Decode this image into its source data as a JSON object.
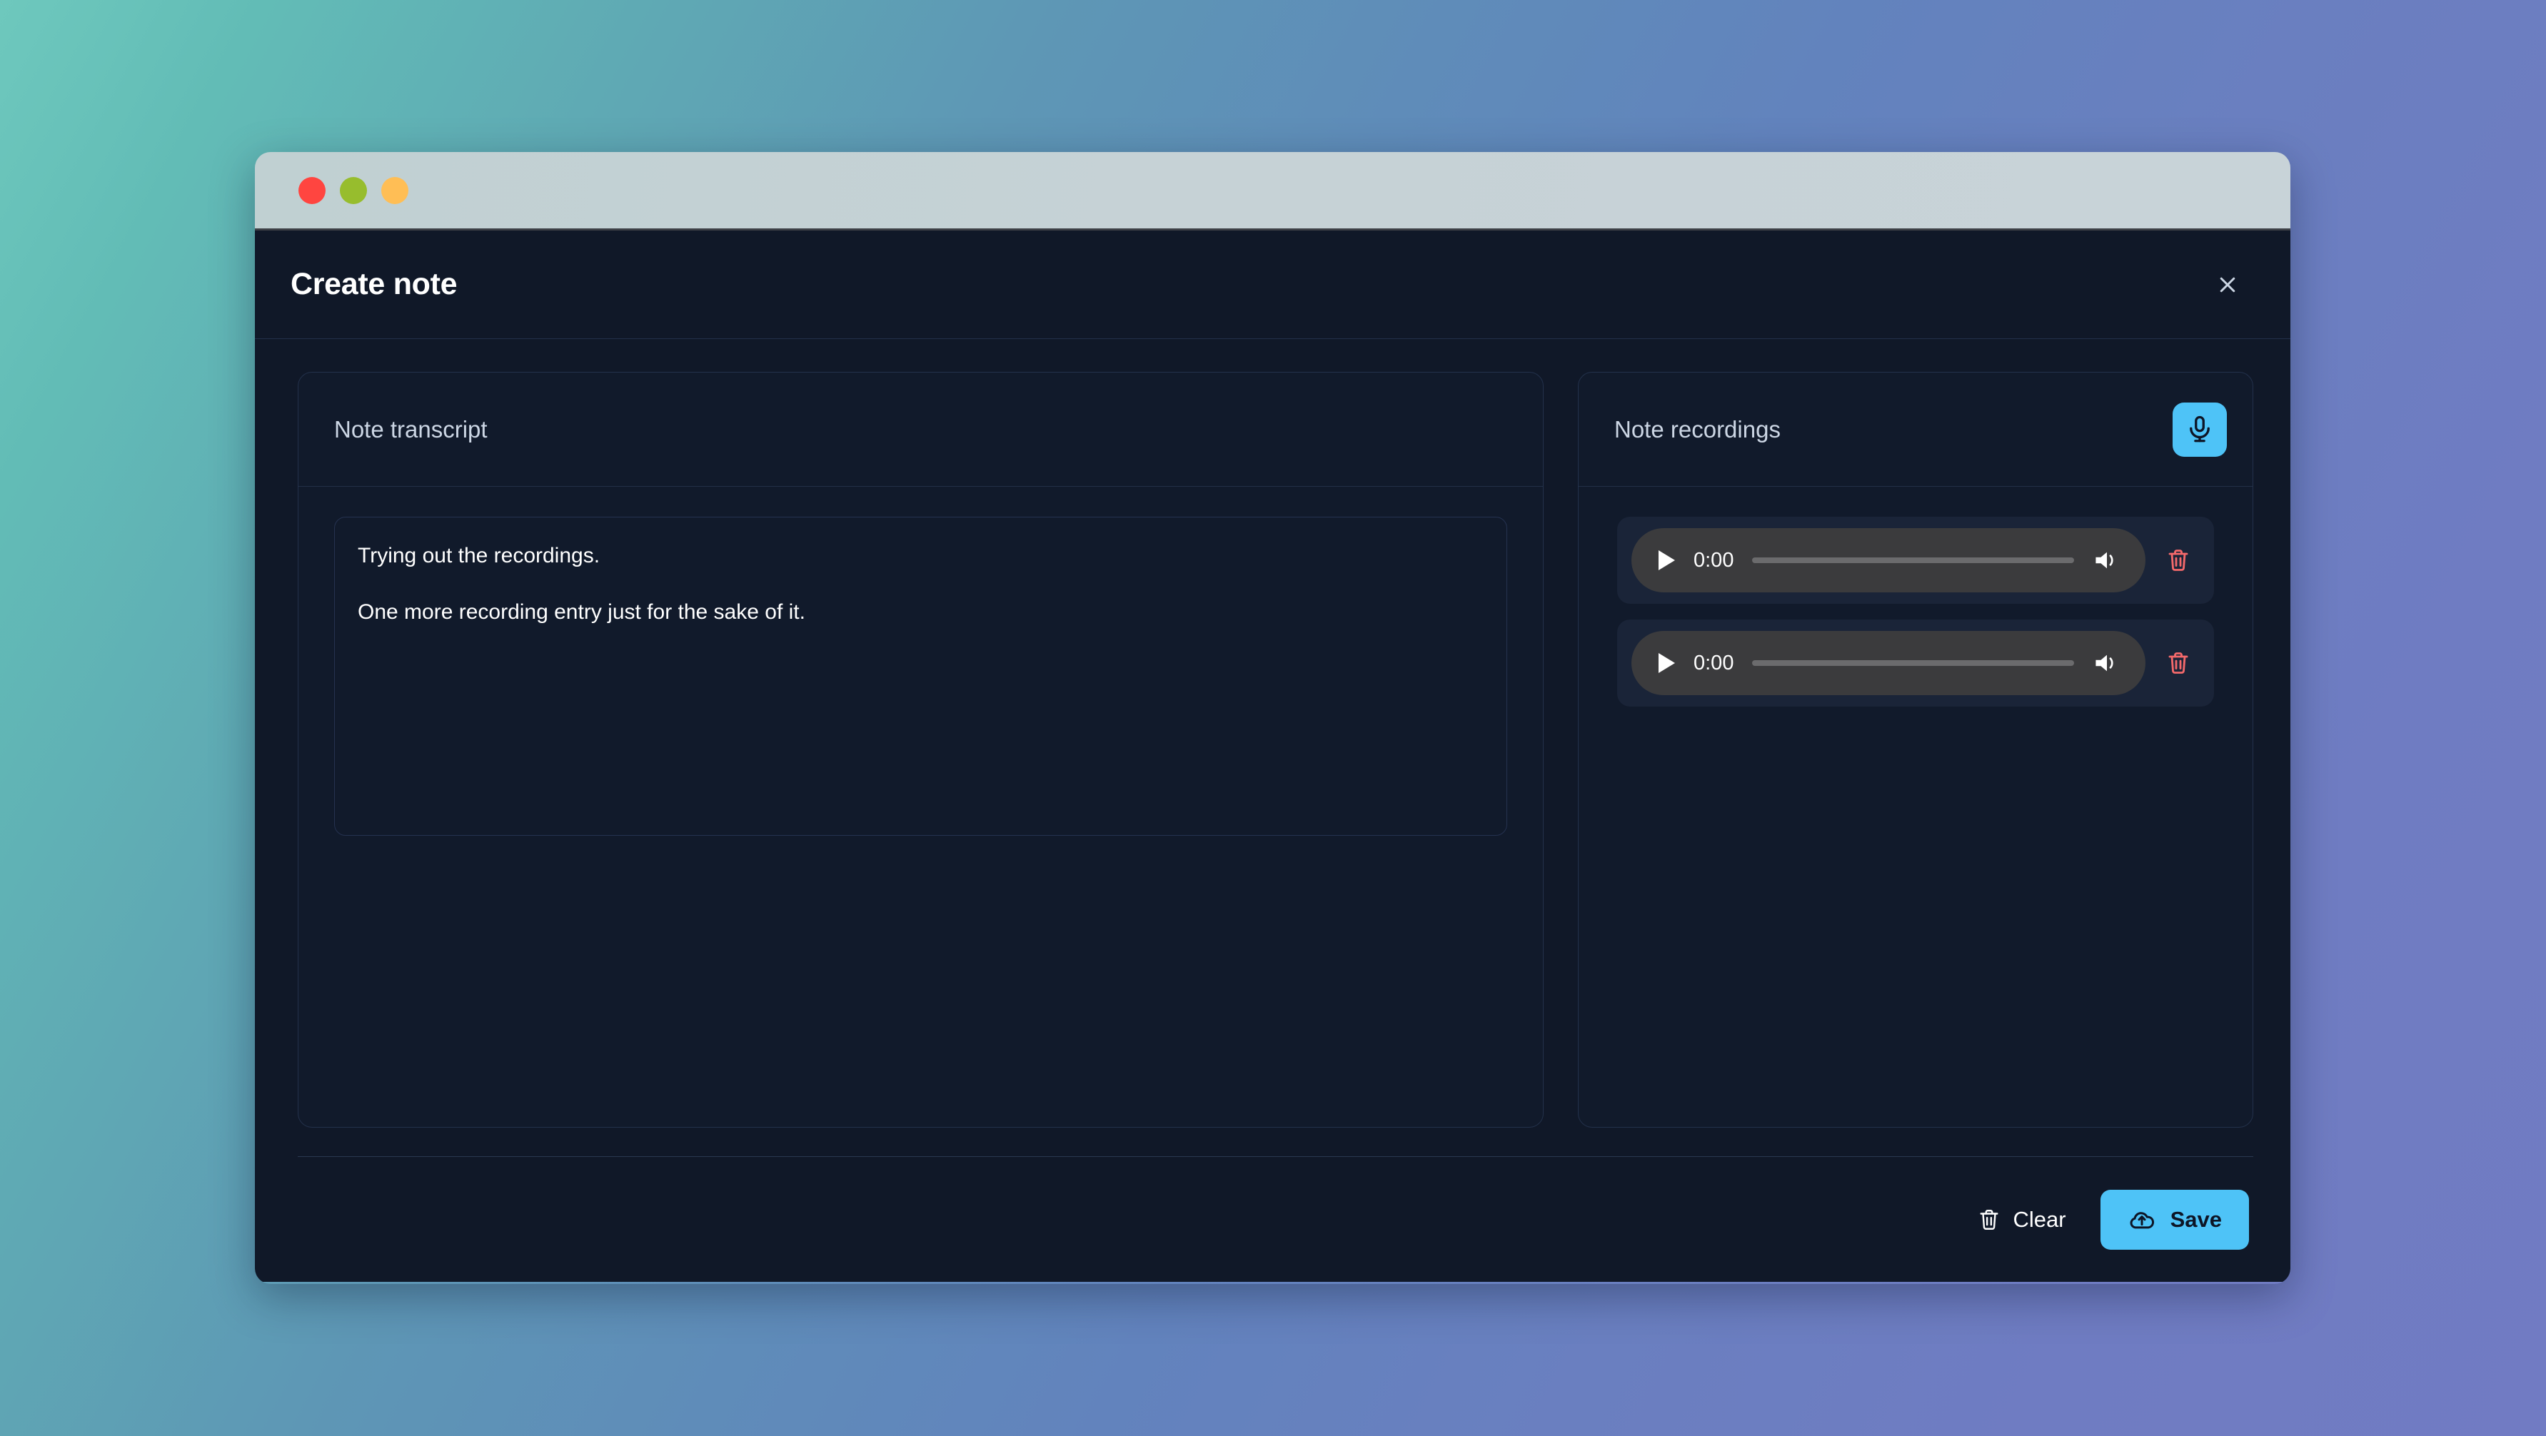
{
  "window": {
    "traffic_lights": [
      {
        "name": "close",
        "color": "#ff4540"
      },
      {
        "name": "minimize",
        "color": "#97bd2d"
      },
      {
        "name": "zoom",
        "color": "#ffbe55"
      }
    ]
  },
  "dialog": {
    "title": "Create note",
    "close_icon": "close-icon"
  },
  "transcript_panel": {
    "title": "Note transcript",
    "text_lines": [
      "Trying out the recordings.",
      "One more recording entry just for the sake of it."
    ],
    "placeholder": "Note transcript"
  },
  "recordings_panel": {
    "title": "Note recordings",
    "record_icon": "microphone-icon",
    "delete_icon": "trash-icon",
    "items": [
      {
        "time": "0:00",
        "play_icon": "play-icon",
        "volume_icon": "volume-icon",
        "progress": 0
      },
      {
        "time": "0:00",
        "play_icon": "play-icon",
        "volume_icon": "volume-icon",
        "progress": 0
      }
    ]
  },
  "footer": {
    "clear_label": "Clear",
    "clear_icon": "trash-icon",
    "save_label": "Save",
    "save_icon": "cloud-upload-icon"
  },
  "colors": {
    "accent": "#4ec3f7",
    "danger": "#f4696b",
    "dialog_bg": "#101828",
    "panel_bg": "#111a2b",
    "panel_border": "#23314b",
    "audio_pill": "#3b3b3d"
  }
}
